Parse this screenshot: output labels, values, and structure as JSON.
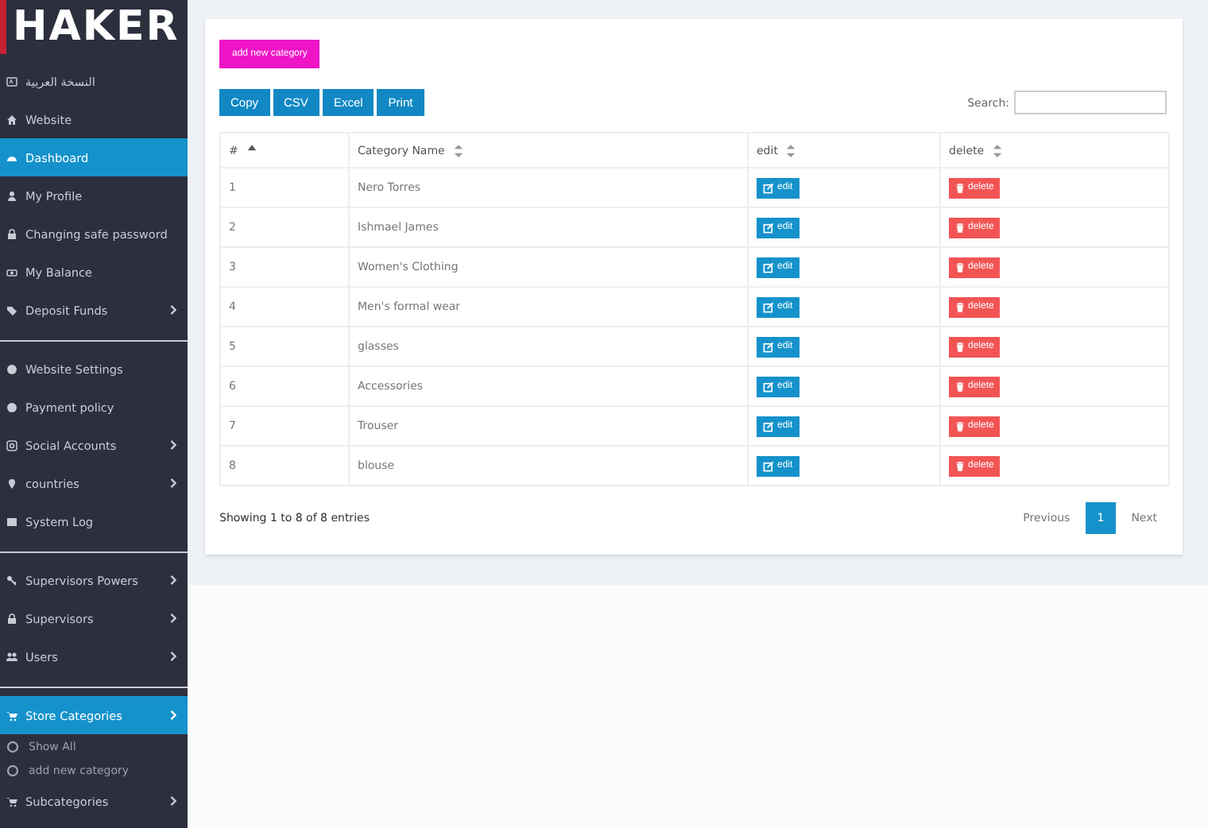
{
  "sidebar": {
    "logo": "HAKER",
    "groups": [
      {
        "items": [
          {
            "label": "النسخة العربية",
            "selected": false,
            "has_submenu": false
          },
          {
            "label": "Website",
            "selected": false,
            "has_submenu": false
          },
          {
            "label": "Dashboard",
            "selected": true,
            "has_submenu": false
          },
          {
            "label": "My Profile",
            "selected": false,
            "has_submenu": false
          },
          {
            "label": "Changing safe password",
            "selected": false,
            "has_submenu": false
          },
          {
            "label": "My Balance",
            "selected": false,
            "has_submenu": false
          },
          {
            "label": "Deposit Funds",
            "selected": false,
            "has_submenu": true
          }
        ]
      },
      {
        "items": [
          {
            "label": "Website Settings",
            "selected": false,
            "has_submenu": false
          },
          {
            "label": "Payment policy",
            "selected": false,
            "has_submenu": false
          },
          {
            "label": "Social Accounts",
            "selected": false,
            "has_submenu": true
          },
          {
            "label": "countries",
            "selected": false,
            "has_submenu": true
          },
          {
            "label": "System Log",
            "selected": false,
            "has_submenu": false
          }
        ]
      },
      {
        "items": [
          {
            "label": "Supervisors Powers",
            "selected": false,
            "has_submenu": true
          },
          {
            "label": "Supervisors",
            "selected": false,
            "has_submenu": true
          },
          {
            "label": "Users",
            "selected": false,
            "has_submenu": true
          }
        ]
      },
      {
        "items": [
          {
            "label": "Store Categories",
            "selected": true,
            "has_submenu": true,
            "children": [
              {
                "label": "Show All"
              },
              {
                "label": "add new category"
              }
            ]
          },
          {
            "label": "Subcategories",
            "selected": false,
            "has_submenu": true
          }
        ]
      }
    ]
  },
  "main": {
    "add_button": "add new category",
    "export_buttons": [
      "Copy",
      "CSV",
      "Excel",
      "Print"
    ],
    "search": {
      "label": "Search:"
    },
    "table": {
      "columns": [
        "#",
        "Category Name",
        "edit",
        "delete"
      ],
      "rows": [
        {
          "number": "1",
          "name": "Nero Torres",
          "edit": "edit",
          "delete": "delete"
        },
        {
          "number": "2",
          "name": "Ishmael James",
          "edit": "edit",
          "delete": "delete"
        },
        {
          "number": "3",
          "name": "Women's Clothing",
          "edit": "edit",
          "delete": "delete"
        },
        {
          "number": "4",
          "name": "Men's formal wear",
          "edit": "edit",
          "delete": "delete"
        },
        {
          "number": "5",
          "name": "glasses",
          "edit": "edit",
          "delete": "delete"
        },
        {
          "number": "6",
          "name": "Accessories",
          "edit": "edit",
          "delete": "delete"
        },
        {
          "number": "7",
          "name": "Trouser",
          "edit": "edit",
          "delete": "delete"
        },
        {
          "number": "8",
          "name": "blouse",
          "edit": "edit",
          "delete": "delete"
        }
      ]
    },
    "info": "Showing 1 to 8 of 8 entries",
    "pagination": [
      {
        "label": "Previous",
        "selected": false
      },
      {
        "label": "1",
        "selected": true
      },
      {
        "label": "Next",
        "selected": false
      }
    ]
  }
}
